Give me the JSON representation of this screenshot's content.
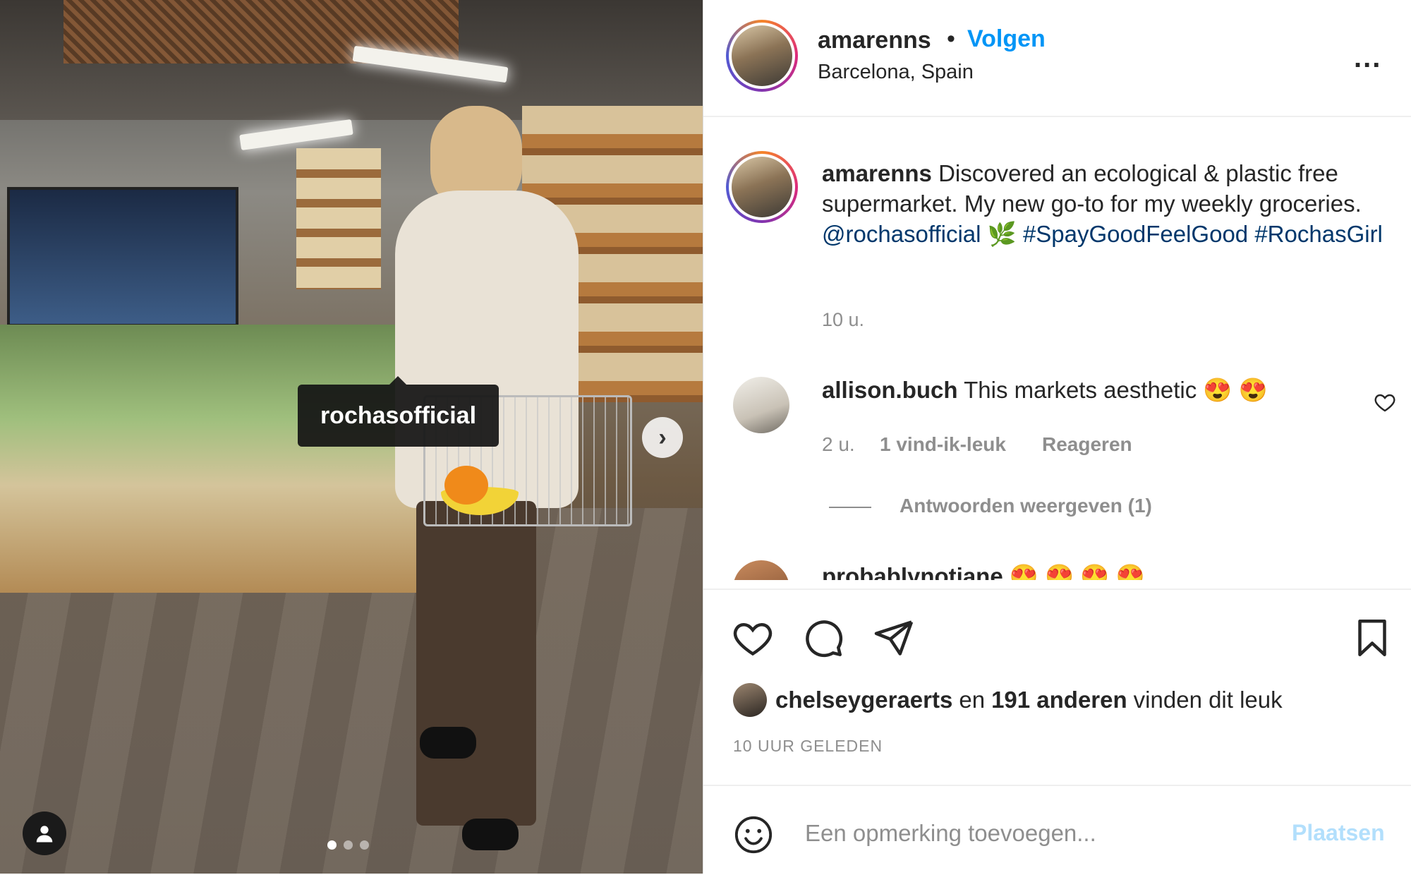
{
  "photo": {
    "tag_label": "rochasofficial",
    "carousel_total": 3,
    "carousel_current": 1
  },
  "header": {
    "username": "amarenns",
    "separator": "•",
    "follow_label": "Volgen",
    "location": "Barcelona, Spain",
    "more_label": "..."
  },
  "caption": {
    "username": "amarenns",
    "text": "Discovered an ecological & plastic free supermarket. My new go-to for my weekly groceries.",
    "mention": "@rochasofficial",
    "emoji": "🌿",
    "hashtags": "#SpayGoodFeelGood #RochasGirl",
    "time": "10 u."
  },
  "comments": [
    {
      "username": "allison.buch",
      "text": "This markets aesthetic 😍 😍",
      "time": "2 u.",
      "likes": "1 vind-ik-leuk",
      "reply_label": "Reageren",
      "view_replies": "Antwoorden weergeven (1)"
    },
    {
      "username": "probablynotjane",
      "text": "😍 😍 😍 😍"
    }
  ],
  "actions": {
    "icons": [
      "heart-icon",
      "comment-icon",
      "share-icon",
      "bookmark-icon"
    ]
  },
  "likes": {
    "first_user": "chelseygeraerts",
    "connector": "en",
    "others": "191 anderen",
    "suffix": "vinden dit leuk"
  },
  "posted_ago": "10 UUR GELEDEN",
  "add_comment": {
    "placeholder": "Een opmerking toevoegen...",
    "post_label": "Plaatsen"
  },
  "colors": {
    "link_blue": "#0095f6",
    "mention_dark_blue": "#00376b",
    "muted": "#8e8e8e",
    "post_disabled": "#b2dffc"
  }
}
